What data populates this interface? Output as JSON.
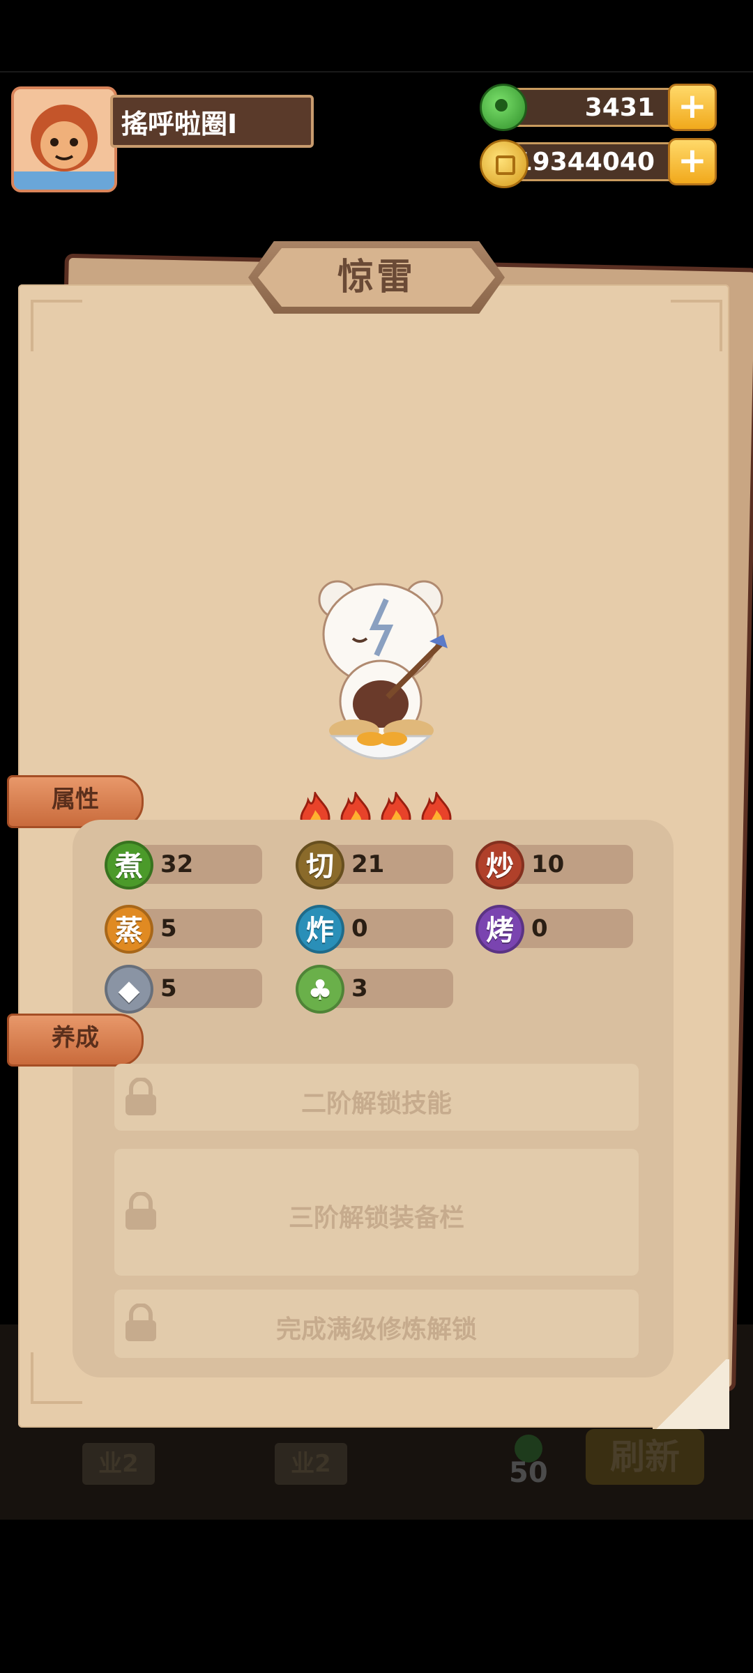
{
  "header": {
    "player_name": "搖呼啦圈I",
    "jade_amount": "3431",
    "coin_amount": "19344040",
    "jade_icon": "jade-icon",
    "coin_icon": "coin-icon",
    "plus_label": "+"
  },
  "panel": {
    "title": "惊雷",
    "star_count": 4,
    "attributes_tab": "属性",
    "training_tab": "养成",
    "stats": [
      {
        "label": "煮",
        "value": "32",
        "color": "#4b9a2a"
      },
      {
        "label": "切",
        "value": "21",
        "color": "#8a6a2a"
      },
      {
        "label": "炒",
        "value": "10",
        "color": "#b0402a"
      },
      {
        "label": "蒸",
        "value": "5",
        "color": "#e08a22"
      },
      {
        "label": "炸",
        "value": "0",
        "color": "#2a8fb8"
      },
      {
        "label": "烤",
        "value": "0",
        "color": "#7a44b0"
      },
      {
        "label": "fish-icon",
        "value": "5",
        "color": "#8a94a4"
      },
      {
        "label": "cabbage-icon",
        "value": "3",
        "color": "#6ab04a"
      }
    ],
    "locks": [
      {
        "text": "二阶解锁技能"
      },
      {
        "text": "三阶解锁装备栏"
      },
      {
        "text": "完成满级修炼解锁"
      }
    ]
  },
  "background": {
    "refresh_label": "刷新",
    "cost": "50",
    "tile_label_1": "业2",
    "tile_label_2": "业2"
  }
}
